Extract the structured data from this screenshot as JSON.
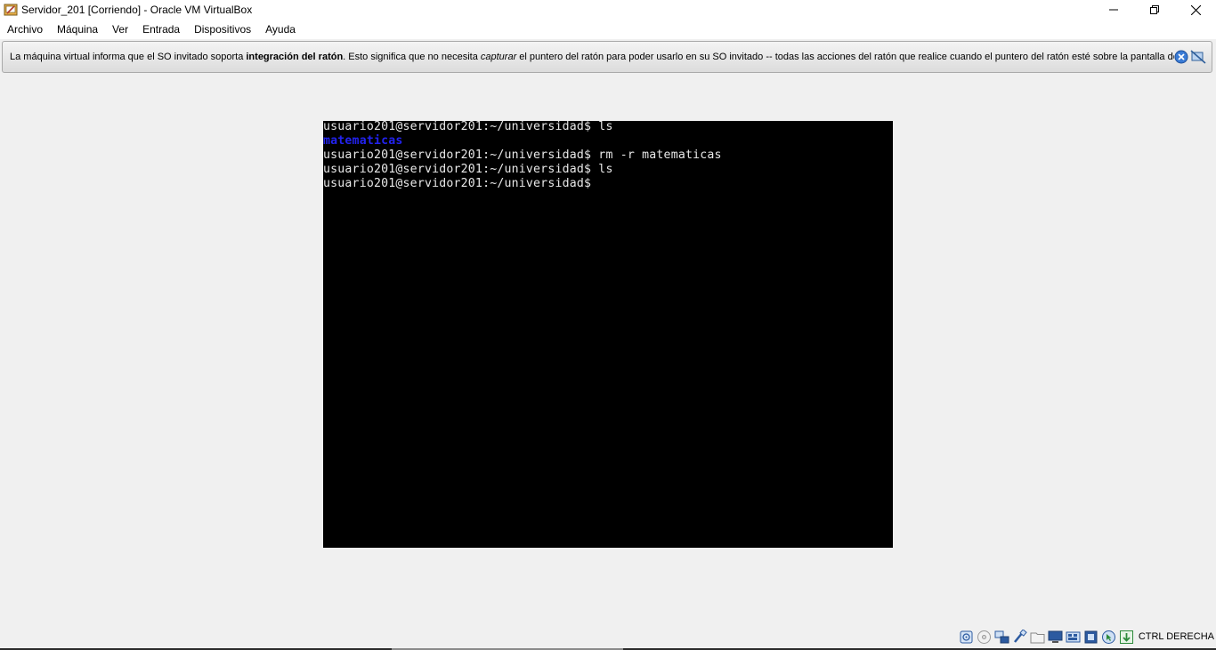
{
  "window": {
    "title": "Servidor_201 [Corriendo] - Oracle VM VirtualBox",
    "controls": {
      "minimize": "—",
      "restore": "❐",
      "close": "✕"
    }
  },
  "menu": {
    "items": [
      "Archivo",
      "Máquina",
      "Ver",
      "Entrada",
      "Dispositivos",
      "Ayuda"
    ]
  },
  "notice": {
    "text_before": "La máquina virtual informa que el SO invitado soporta ",
    "bold": "integración del ratón",
    "text_middle": ". Esto significa que no necesita ",
    "italic": "capturar",
    "text_after": " el puntero del ratón para poder usarlo en su SO invitado -- todas las acciones del ratón que realice cuando el puntero del ratón esté sobre la pantalla de"
  },
  "terminal": {
    "lines": [
      {
        "text": "usuario201@servidor201:~/universidad$ ls",
        "kind": "normal"
      },
      {
        "text": "matematicas",
        "kind": "dir"
      },
      {
        "text": "usuario201@servidor201:~/universidad$ rm -r matematicas",
        "kind": "normal"
      },
      {
        "text": "usuario201@servidor201:~/universidad$ ls",
        "kind": "normal"
      },
      {
        "text": "usuario201@servidor201:~/universidad$",
        "kind": "normal"
      }
    ]
  },
  "statusbar": {
    "icons": [
      "hard-disk-icon",
      "optical-drive-icon",
      "audio-icon",
      "network-icon",
      "usb-icon",
      "shared-folders-icon",
      "display-icon",
      "video-capture-icon",
      "cpu-icon",
      "mouse-integration-icon",
      "keyboard-capture-icon"
    ],
    "host_key": "CTRL DERECHA"
  },
  "colors": {
    "window_bg": "#f0f0f0",
    "vm_bg": "#000000",
    "term_text": "#e8e8e8",
    "term_dir": "#2222ee"
  }
}
